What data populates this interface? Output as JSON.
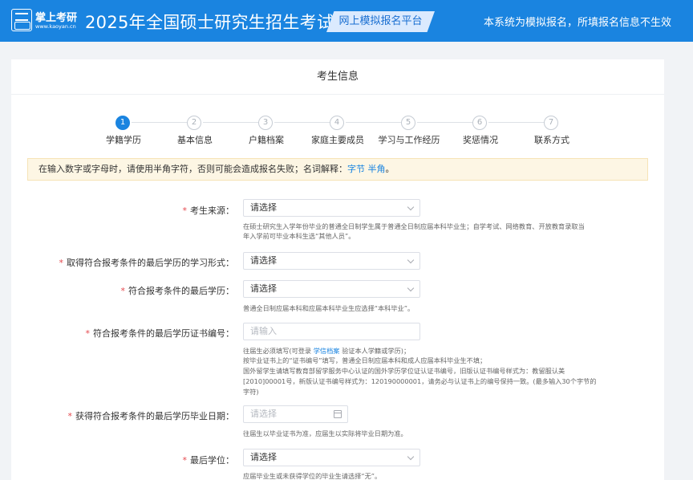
{
  "header": {
    "logo_name": "掌上考研",
    "logo_url": "www.kaoyan.cn",
    "title": "2025年全国硕士研究生招生考试",
    "badge": "网上模拟报名平台",
    "notice": "本系统为模拟报名，所填报名信息不生效"
  },
  "card": {
    "title": "考生信息"
  },
  "steps": [
    {
      "num": "1",
      "label": "学籍学历",
      "active": true
    },
    {
      "num": "2",
      "label": "基本信息"
    },
    {
      "num": "3",
      "label": "户籍档案"
    },
    {
      "num": "4",
      "label": "家庭主要成员"
    },
    {
      "num": "5",
      "label": "学习与工作经历"
    },
    {
      "num": "6",
      "label": "奖惩情况"
    },
    {
      "num": "7",
      "label": "联系方式"
    }
  ],
  "alert": {
    "text": "在输入数字或字母时，请使用半角字符，否则可能会造成报名失败；名词解释：",
    "link1": "字节",
    "link2": "半角",
    "end": "。"
  },
  "form": {
    "source": {
      "label": "考生来源：",
      "value": "请选择",
      "help1": "在硕士研究生入学年份毕业的普通全日制学生属于普通全日制应届本科毕业生；自学考试、网络教育、开放教育录取当",
      "help2": "年入学前可毕业本科生选“其他人员”。"
    },
    "study_form": {
      "label": "取得符合报考条件的最后学历的学习形式：",
      "value": "请选择"
    },
    "last_edu": {
      "label": "符合报考条件的最后学历：",
      "value": "请选择",
      "help1": "普通全日制应届本科和应届本科毕业生应选择“本科毕业”。"
    },
    "cert_no": {
      "label": "符合报考条件的最后学历证书编号：",
      "placeholder": "请输入",
      "help1a": "往届生必须填写(可登录",
      "help1link": "学信档案",
      "help1b": "验证本人学籍或学历)；",
      "help2": "按毕业证书上的“证书编号”填写，普通全日制应届本科和成人应届本科毕业生不填；",
      "help3": "国外留学生请填写教育部留学服务中心认证的国外学历学位证认证书编号，旧版认证书编号样式为：教留服认美",
      "help4": "[2010]00001号，新版认证书编号样式为：120190000001，请务必与认证书上的编号保持一致。(最多输入30个字节的",
      "help5": "字符)"
    },
    "grad_date": {
      "label": "获得符合报考条件的最后学历毕业日期：",
      "placeholder": "请选择",
      "help1": "往届生以毕业证书为准，应届生以实际将毕业日期为准。"
    },
    "degree": {
      "label": "最后学位：",
      "value": "请选择",
      "help1": "应届毕业生或未获得学位的毕业生请选择“无”。"
    }
  },
  "colors": {
    "header_bg": "#1a84e0",
    "accent": "#1a84e0",
    "required": "#e5484d",
    "alert_bg": "#fdf6e4"
  }
}
